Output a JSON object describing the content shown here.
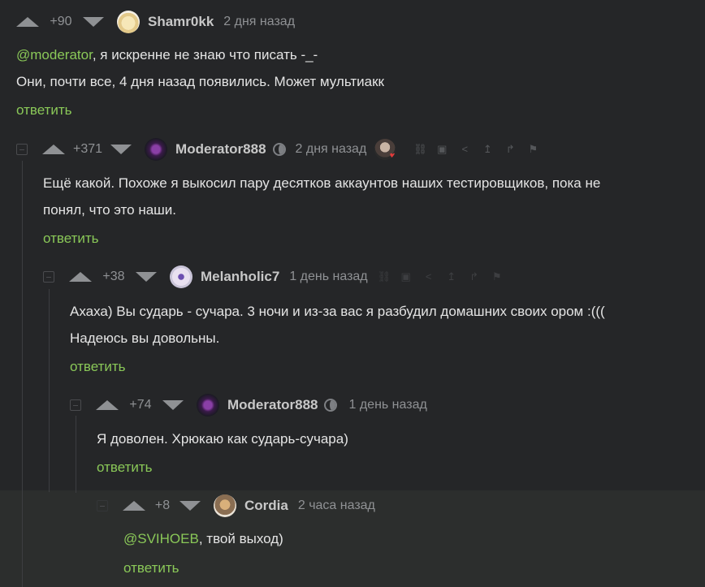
{
  "comments": [
    {
      "rating": "+90",
      "author": "Shamr0kk",
      "time": "2 дня назад",
      "mention": "@moderator",
      "line1_rest": ", я искренне не знаю что писать -_-",
      "line2": "Они, почти все, 4 дня назад появились. Может мультиакк",
      "reply": "ответить"
    },
    {
      "rating": "+371",
      "author": "Moderator888",
      "time": "2 дня назад",
      "line1": "Ещё какой. Похоже я выкосил пару десятков аккаунтов наших тестировщиков, пока не",
      "line2": "понял, что это наши.",
      "reply": "ответить"
    },
    {
      "rating": "+38",
      "author": "Melanholic7",
      "time": "1 день назад",
      "line1": "Ахаха) Вы сударь - сучара. 3 ночи и из-за вас я разбудил домашних своих ором :(((",
      "line2": "Надеюсь вы довольны.",
      "reply": "ответить"
    },
    {
      "rating": "+74",
      "author": "Moderator888",
      "time": "1 день назад",
      "line1": "Я доволен. Хрюкаю как сударь-сучара)",
      "reply": "ответить"
    },
    {
      "rating": "+8",
      "author": "Cordia",
      "time": "2 часа назад",
      "mention": "@SVIHOEB",
      "line1_rest": ", твой выход)",
      "reply": "ответить"
    }
  ],
  "icons": {
    "tools": [
      "link-icon",
      "save-icon",
      "share-icon",
      "arrow-up-icon",
      "branch-icon",
      "flag-icon"
    ]
  },
  "colors": {
    "background": "#252628",
    "highlight": "#2c2e2d",
    "accent": "#8ac858",
    "muted": "#8f9194"
  }
}
